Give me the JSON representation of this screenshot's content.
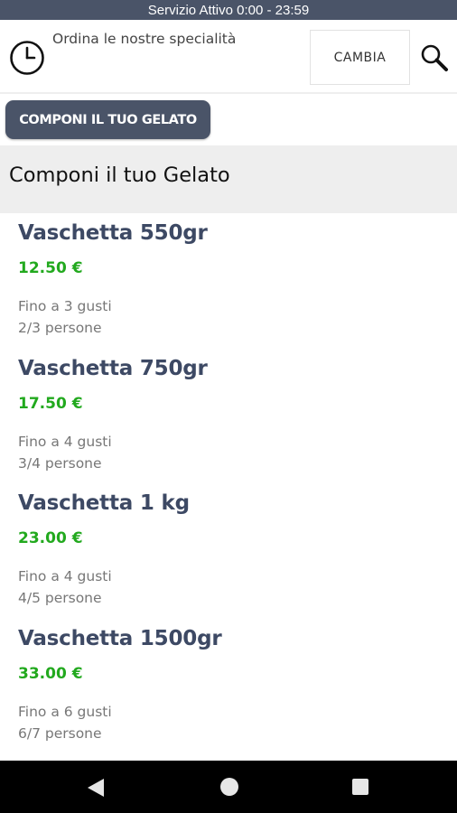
{
  "status_bar": {
    "text": "Servizio Attivo  0:00 - 23:59"
  },
  "header": {
    "subtitle": "Ordina le nostre specialità",
    "change_label": "CAMBIA",
    "icons": {
      "clock": "clock-icon",
      "search": "search-icon"
    }
  },
  "compose_button": {
    "label": "COMPONI IL TUO GELATO"
  },
  "section": {
    "title": "Componi il tuo Gelato"
  },
  "products": [
    {
      "name": "Vaschetta 550gr",
      "price": "12.50 €",
      "flavors": "Fino a 3 gusti",
      "people": "2/3 persone"
    },
    {
      "name": "Vaschetta 750gr",
      "price": "17.50 €",
      "flavors": "Fino a 4 gusti",
      "people": "3/4 persone"
    },
    {
      "name": "Vaschetta 1 kg",
      "price": "23.00 €",
      "flavors": "Fino a 4 gusti",
      "people": "4/5 persone"
    },
    {
      "name": "Vaschetta 1500gr",
      "price": "33.00 €",
      "flavors": "Fino a 6 gusti",
      "people": "6/7 persone"
    }
  ],
  "nav_bar": {
    "icons": [
      "back-icon",
      "home-icon",
      "recent-apps-icon"
    ]
  },
  "colors": {
    "accent": "#4a5468",
    "price": "#22a91e",
    "product_name": "#3d4964"
  }
}
